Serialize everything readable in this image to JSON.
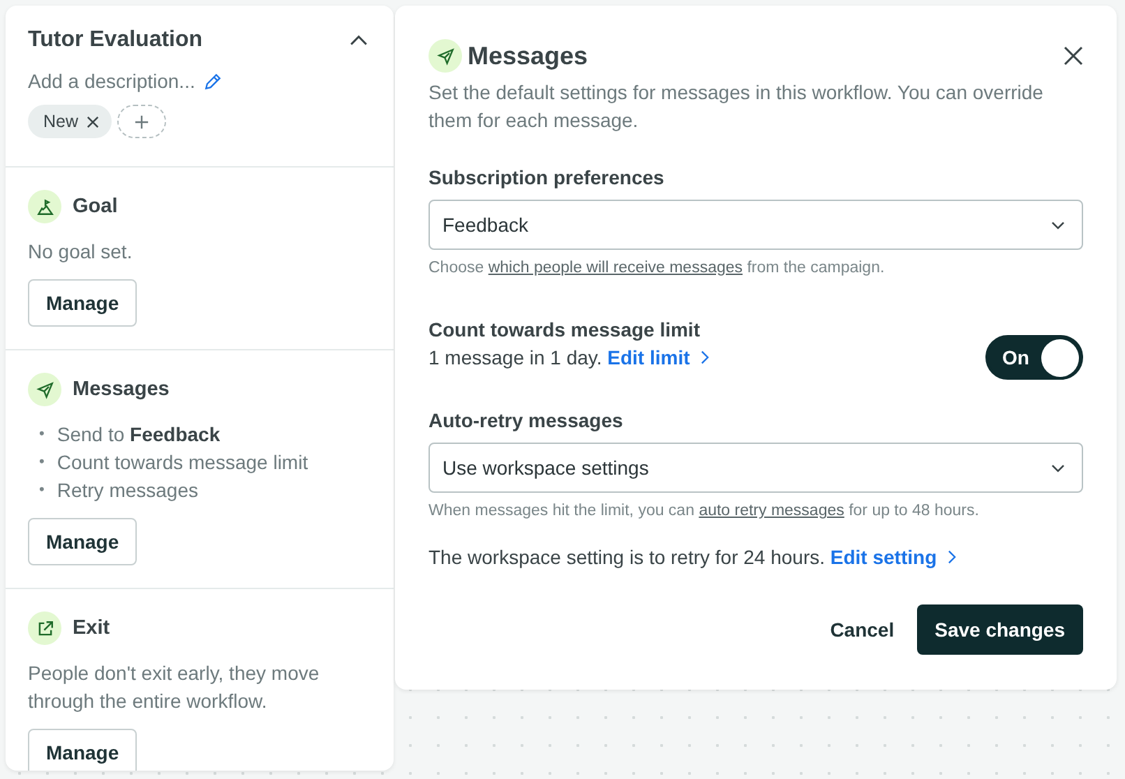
{
  "sidebar": {
    "title": "Tutor Evaluation",
    "expanded": true,
    "description_placeholder": "Add a description...",
    "tags": [
      {
        "label": "New"
      }
    ],
    "sections": [
      {
        "kind": "goal",
        "title": "Goal",
        "text": "No goal set.",
        "button": "Manage"
      },
      {
        "kind": "messages",
        "title": "Messages",
        "bullets": [
          {
            "marker": "•",
            "text": "Send to **Feedback**"
          },
          {
            "marker": "•",
            "text": "Count towards message limit"
          },
          {
            "marker": "•",
            "text": "Retry messages"
          }
        ],
        "button": "Manage"
      },
      {
        "kind": "exit",
        "title": "Exit",
        "text": "People don't exit early, they move through the entire workflow.",
        "button": "Manage"
      }
    ]
  },
  "panel": {
    "title": "Messages",
    "description": "Set the default settings for messages in this workflow. You can override them for each message.",
    "subscription": {
      "label": "Subscription preferences",
      "value": "Feedback",
      "hint": {
        "before": "Choose",
        "link": "which people will receive messages",
        "after": "from the campaign."
      }
    },
    "limit": {
      "label": "Count towards message limit",
      "text": "1 message in 1 day.",
      "link": "Edit limit",
      "toggle": {
        "on": true,
        "label": "On"
      }
    },
    "retry": {
      "label": "Auto-retry messages",
      "value": "Use workspace settings",
      "hint": {
        "before": "When messages hit the limit, you can",
        "link": "auto retry messages",
        "after": "for up to 48 hours."
      },
      "note": "The workspace setting is to retry for 24 hours.",
      "link": "Edit setting"
    },
    "buttons": {
      "cancel": "Cancel",
      "save": "Save changes"
    }
  }
}
